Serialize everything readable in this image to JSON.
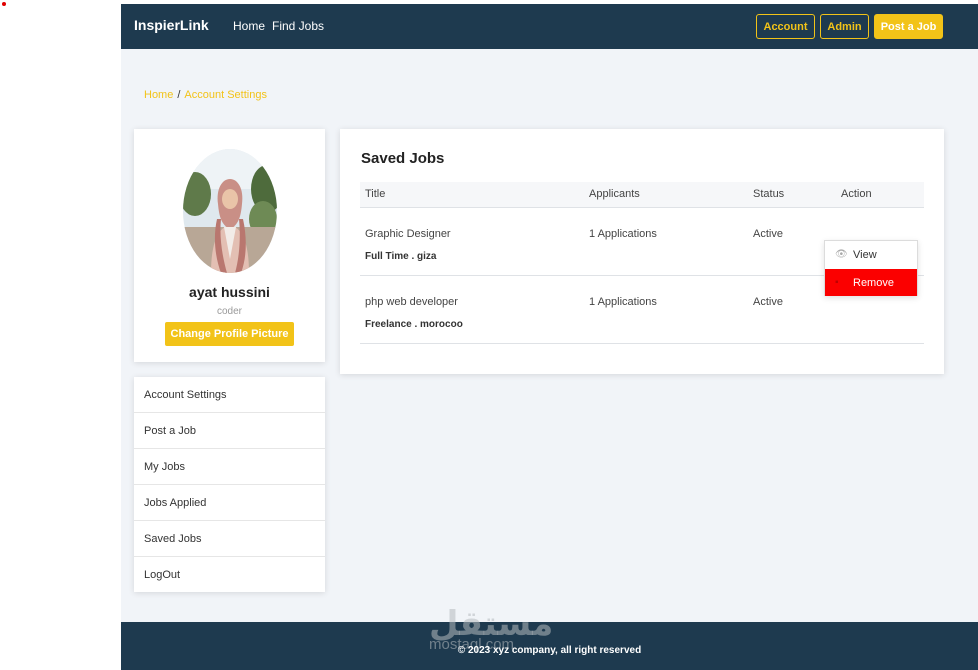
{
  "navbar": {
    "brand": "InspierLink",
    "links": [
      "Home",
      "Find Jobs"
    ],
    "buttons": [
      "Account",
      "Admin",
      "Post a Job"
    ]
  },
  "breadcrumb": {
    "home": "Home",
    "separator": "/",
    "current": "Account Settings"
  },
  "profile": {
    "name": "ayat hussini",
    "role": "coder",
    "change_picture": "Change Profile Picture"
  },
  "side_menu": {
    "items": [
      "Account Settings",
      "Post a Job",
      "My Jobs",
      "Jobs Applied",
      "Saved Jobs",
      "LogOut"
    ]
  },
  "saved_jobs": {
    "title": "Saved Jobs",
    "columns": [
      "Title",
      "Applicants",
      "Status",
      "Action"
    ],
    "rows": [
      {
        "title": "Graphic Designer",
        "meta": "Full Time . giza",
        "applicants": "1 Applications",
        "status": "Active"
      },
      {
        "title": "php web developer",
        "meta": "Freelance . morocoo",
        "applicants": "1 Applications",
        "status": "Active"
      }
    ],
    "action_menu": {
      "view": "View",
      "remove": "Remove"
    }
  },
  "footer": {
    "text": "© 2023 xyz company, all right reserved",
    "watermark": "مستقل",
    "watermark_sub": "mostaql.com"
  },
  "colors": {
    "navbar": "#1e3a4f",
    "accent": "#f2c318",
    "danger": "#fb0000",
    "background": "#f1f4f8"
  },
  "icons": {
    "view": "eye-icon",
    "remove": "trash-icon"
  }
}
